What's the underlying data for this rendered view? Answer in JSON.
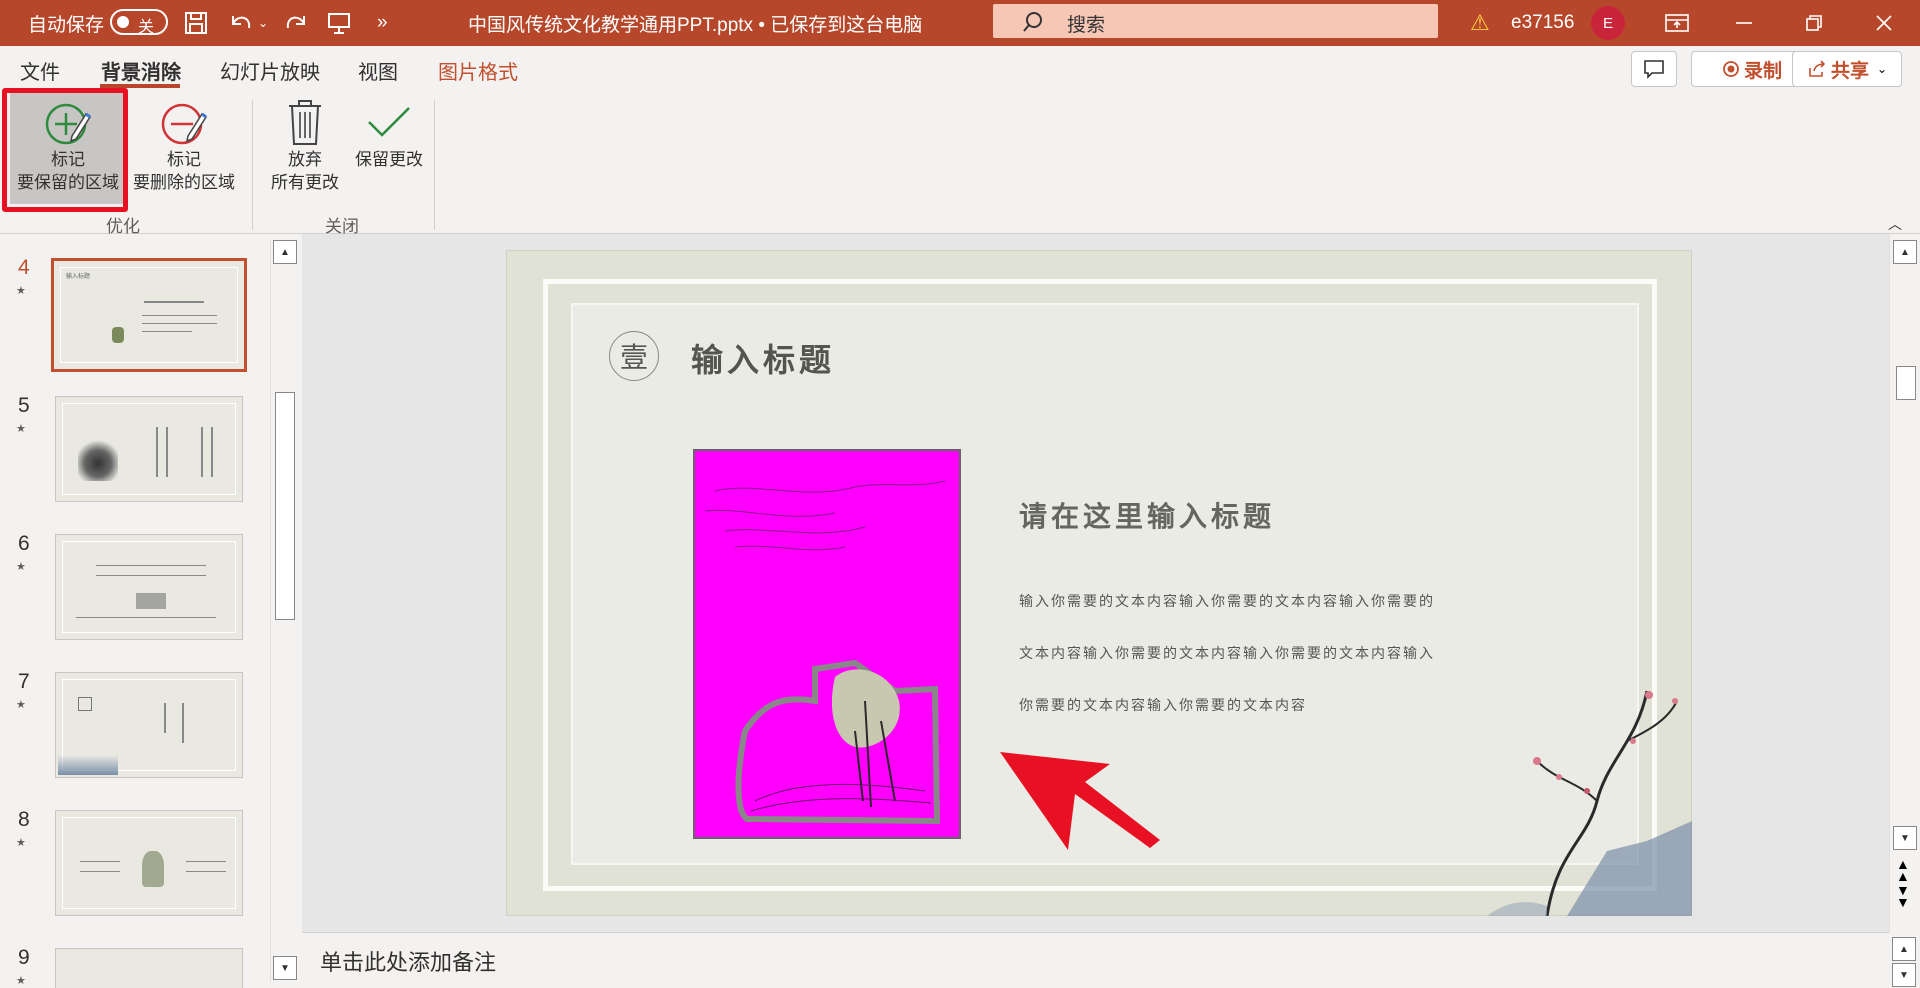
{
  "titlebar": {
    "autosave_label": "自动保存",
    "autosave_state": "关",
    "doc_title": "中国风传统文化教学通用PPT.pptx • 已保存到这台电脑",
    "more": "»",
    "search_placeholder": "搜索",
    "warning": "⚠",
    "username": "e37156",
    "avatar_initial": "E"
  },
  "menu": {
    "items": [
      "文件",
      "背景消除",
      "幻灯片放映",
      "视图",
      "图片格式"
    ],
    "active_index": 1,
    "comment_icon": "comment-icon",
    "record_label": "录制",
    "share_label": "共享"
  },
  "ribbon": {
    "mark_keep_line1": "标记",
    "mark_keep_line2": "要保留的区域",
    "mark_remove_line1": "标记",
    "mark_remove_line2": "要删除的区域",
    "discard_line1": "放弃",
    "discard_line2": "所有更改",
    "keep_changes": "保留更改",
    "group_refine": "优化",
    "group_close": "关闭"
  },
  "thumbnails": [
    {
      "num": "4",
      "active": true
    },
    {
      "num": "5",
      "active": false
    },
    {
      "num": "6",
      "active": false
    },
    {
      "num": "7",
      "active": false
    },
    {
      "num": "8",
      "active": false
    },
    {
      "num": "9",
      "active": false
    }
  ],
  "thumb_labels": {
    "small_title": "输入标题",
    "small_sub": "请在这里输入标题"
  },
  "slide": {
    "seal_char": "壹",
    "title": "输入标题",
    "subtitle": "请在这里输入标题",
    "body": [
      "输入你需要的文本内容输入你需要的文本内容输入你需要的",
      "文本内容输入你需要的文本内容输入你需要的文本内容输入",
      "你需要的文本内容输入你需要的文本内容"
    ]
  },
  "notes": {
    "placeholder": "单击此处添加备注"
  },
  "colors": {
    "titlebar": "#b7472a",
    "accent": "#c1502e",
    "magenta": "#ff00ff",
    "highlight": "#e81123"
  }
}
